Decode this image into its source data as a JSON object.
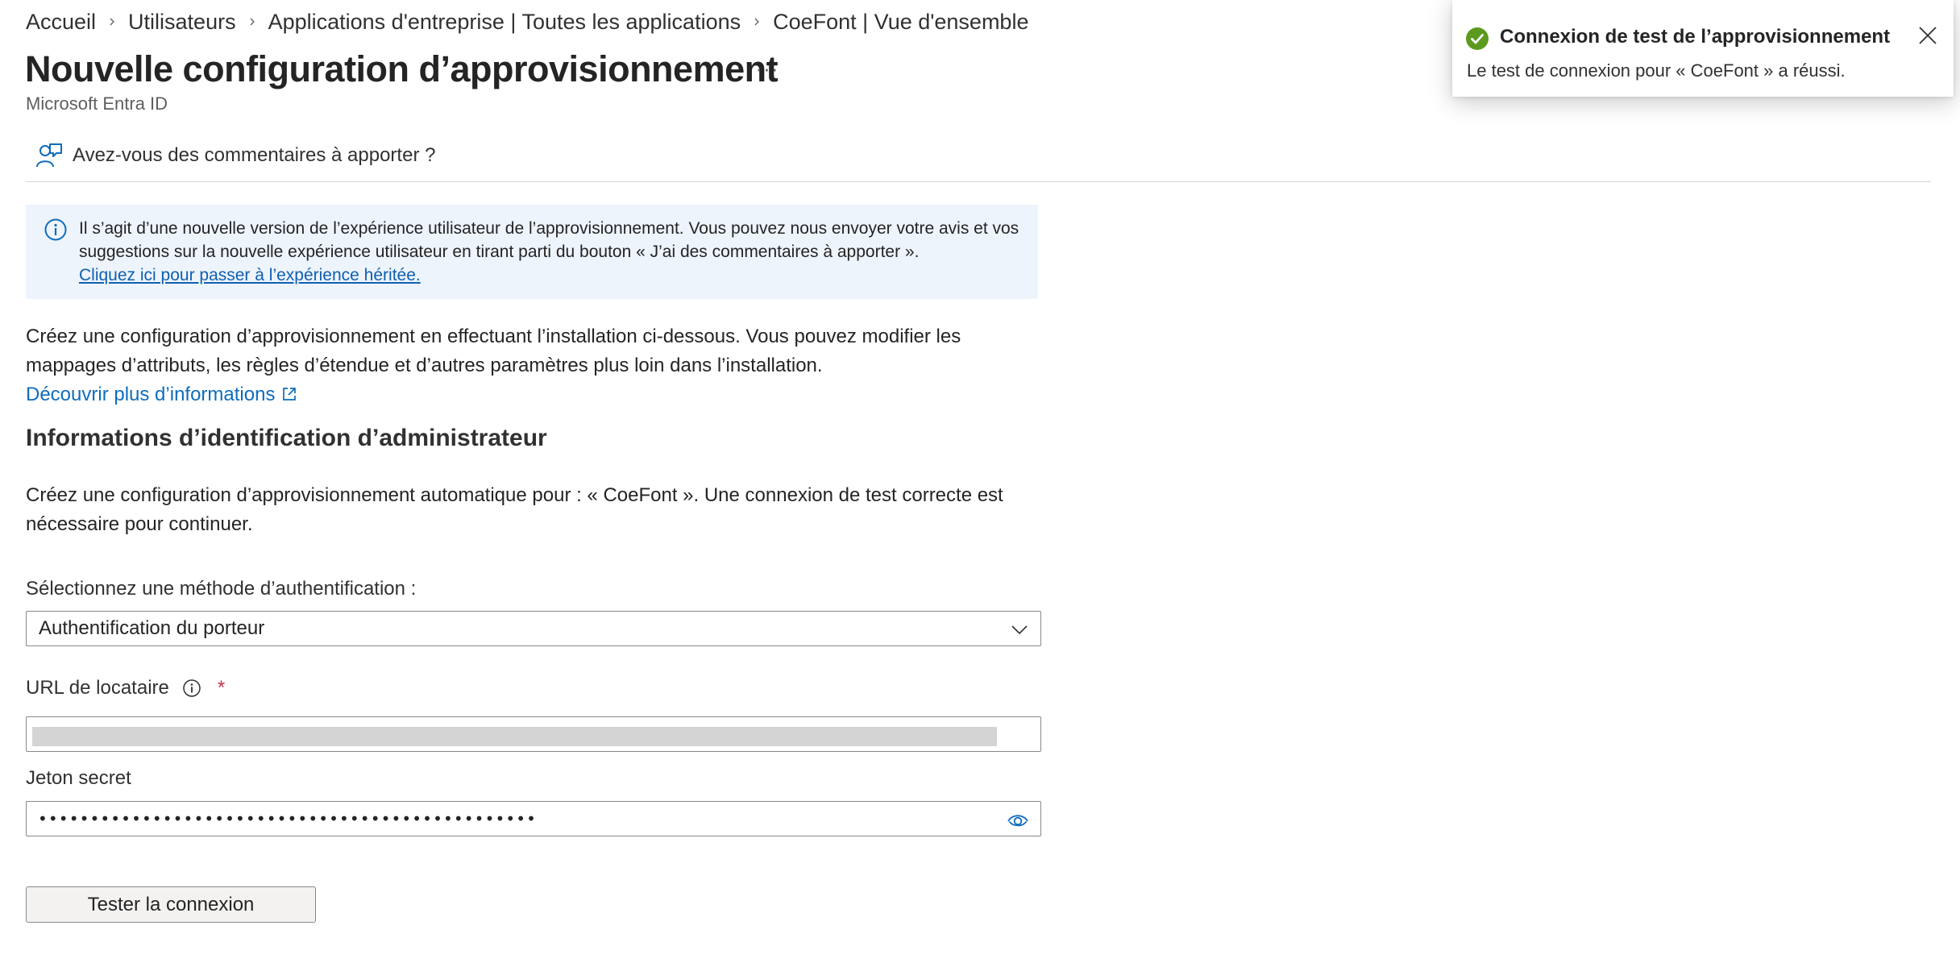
{
  "breadcrumb": [
    {
      "label": "Accueil"
    },
    {
      "label": "Utilisateurs"
    },
    {
      "label": "Applications d'entreprise | Toutes les applications"
    },
    {
      "label": "CoeFont | Vue d'ensemble"
    }
  ],
  "header": {
    "title": "Nouvelle configuration d’approvisionnement",
    "more_label": "···",
    "subtitle": "Microsoft Entra ID"
  },
  "feedback": {
    "label": "Avez-vous des commentaires à apporter ?",
    "icon": "feedback-person-icon"
  },
  "info_banner": {
    "icon": "info-icon",
    "text": "Il s’agit d’une nouvelle version de l’expérience utilisateur de l’approvisionnement. Vous pouvez nous envoyer votre avis et vos suggestions sur la nouvelle expérience utilisateur en tirant parti du bouton « J’ai des commentaires à apporter ».",
    "link": "Cliquez ici pour passer à l’expérience héritée."
  },
  "intro": {
    "text": "Créez une configuration d’approvisionnement en effectuant l’installation ci-dessous. Vous pouvez modifier les mappages d’attributs, les règles d’étendue et d’autres paramètres plus loin dans l’installation.",
    "link": "Découvrir plus d’informations",
    "link_icon": "external-link-icon"
  },
  "section": {
    "title": "Informations d’identification d’administrateur",
    "description": "Créez une configuration d’approvisionnement automatique pour : « CoeFont ». Une connexion de test correcte est nécessaire pour continuer."
  },
  "form": {
    "auth_method_label": "Sélectionnez une méthode d’authentification :",
    "auth_method_value": "Authentification du porteur",
    "tenant_url_label": "URL de locataire",
    "required_marker": "*",
    "secret_token_label": "Jeton secret",
    "secret_token_value": "••••••••••••••••••••••••••••••••••••••••••••••••"
  },
  "actions": {
    "test_connection_label": "Tester la connexion"
  },
  "toast": {
    "title": "Connexion de test de l’approvisionnement",
    "body": "Le test de connexion pour « CoeFont » a réussi.",
    "status_color": "#5b9a1e"
  },
  "colors": {
    "link": "#0f6cbd",
    "info_background": "#eef4fc",
    "required": "#c4314b"
  }
}
